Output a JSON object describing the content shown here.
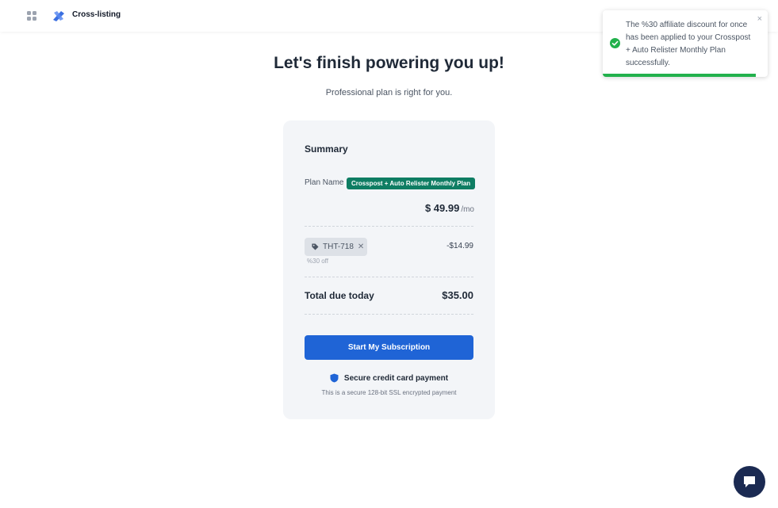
{
  "header": {
    "brand": "Cross-listing",
    "apps_icon": "grid-icon",
    "logo_icon": "logo-icon"
  },
  "hero": {
    "title": "Let's finish powering you up!",
    "subtitle": "Professional plan is right for you."
  },
  "summary": {
    "title": "Summary",
    "plan_label": "Plan Name",
    "plan_name": "Crosspost + Auto Relister Monthly Plan",
    "price": "$ 49.99",
    "price_period": "/mo",
    "coupon_code": "THT-718",
    "coupon_off": "%30 off",
    "discount_amount": "-$14.99",
    "total_label": "Total due today",
    "total_value": "$35.00",
    "cta_label": "Start My Subscription",
    "secure_label": "Secure credit card payment",
    "ssl_note": "This is a secure 128-bit SSL encrypted payment"
  },
  "toast": {
    "message": "The %30 affiliate discount for once has been applied to your Crosspost + Auto Relister Monthly Plan successfully.",
    "close_label": "×",
    "progress": 0.93
  },
  "colors": {
    "badge": "#0e7d63",
    "cta": "#1f64d6",
    "success": "#22b14c",
    "chat": "#1b2a52",
    "card_bg": "#f3f5f8"
  }
}
